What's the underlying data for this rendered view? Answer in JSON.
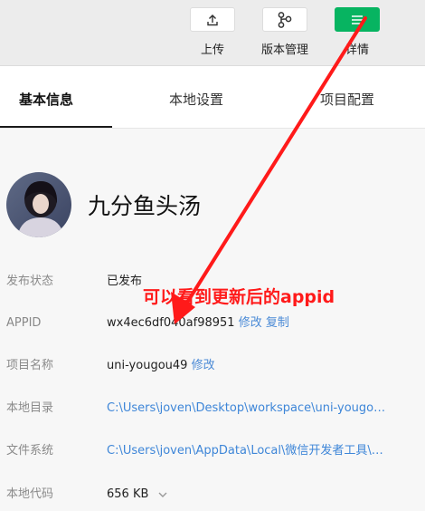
{
  "toolbar": {
    "upload_label": "上传",
    "version_label": "版本管理",
    "details_label": "详情",
    "details_button_color": "#07b461"
  },
  "tabs": [
    {
      "label": "基本信息",
      "active": true
    },
    {
      "label": "本地设置",
      "active": false
    },
    {
      "label": "项目配置",
      "active": false
    }
  ],
  "project": {
    "name": "九分鱼头汤"
  },
  "info": {
    "status": {
      "key": "发布状态",
      "value": "已发布"
    },
    "appid": {
      "key": "APPID",
      "value": "wx4ec6df040af98951",
      "edit": "修改",
      "copy": "复制"
    },
    "name": {
      "key": "项目名称",
      "value": "uni-yougou49",
      "edit": "修改"
    },
    "dir": {
      "key": "本地目录",
      "value": "C:\\Users\\joven\\Desktop\\workspace\\uni-yougou49..."
    },
    "fs": {
      "key": "文件系统",
      "value": "C:\\Users\\joven\\AppData\\Local\\微信开发者工具\\Us..."
    },
    "code": {
      "key": "本地代码",
      "value": "656 KB"
    }
  },
  "annotation": {
    "text": "可以看到更新后的appid",
    "color": "#ff1a1a"
  },
  "icons": {
    "upload": "upload-icon",
    "version": "branch-icon",
    "details": "menu-icon",
    "dropdown": "chevron-down-icon"
  }
}
